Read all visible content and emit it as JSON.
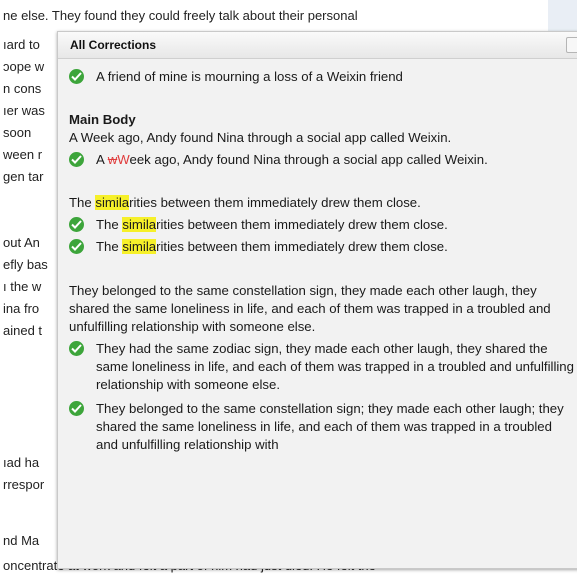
{
  "background_lines": [
    "ne else. They found they could freely talk about their personal",
    "ıard to",
    "ɔope w",
    "n cons",
    "ıer was",
    "soon",
    "ween r",
    "gen tar",
    "",
    "out An",
    "efly bas",
    "ı the w",
    "ina fro",
    "ained t",
    "",
    "",
    "ıad ha",
    "rrespor",
    "",
    "nd Ma",
    "oncentrate at work and felt a part of him had just died. He felt the"
  ],
  "panel": {
    "title": "All Corrections",
    "first_item": "A friend of mine is mourning a loss of a Weixin friend",
    "main_body_heading": "Main Body",
    "main_body_text": "A Week ago, Andy found Nina through a social app called Weixin.",
    "item2": {
      "pre": "A ",
      "del": "w",
      "ins": "W",
      "post": "eek ago, Andy found Nina through a social app called Weixin."
    },
    "sim_sentence": {
      "pre": "The ",
      "hl": "simila",
      "post": "rities between them immediately drew them close."
    },
    "para3": "They belonged to the same constellation sign, they made each other laugh, they shared the same loneliness in life, and each of them was trapped in a troubled and unfulfilling relationship with someone else.",
    "item_zodiac": "They had the same zodiac sign, they made each other laugh, they shared the same loneliness in life, and each of them was trapped in a troubled and unfulfilling relationship with someone else.",
    "item_semicolon": "They belonged to the same constellation sign; they made each other laugh; they shared the same loneliness in life, and each of them was trapped in a troubled and unfulfilling relationship with"
  },
  "colors": {
    "check_green": "#3da53b",
    "highlight": "#f6f02a",
    "correction_red": "#e03a3a"
  },
  "icons": {
    "check": "check-circle-icon",
    "close": "close-icon"
  }
}
